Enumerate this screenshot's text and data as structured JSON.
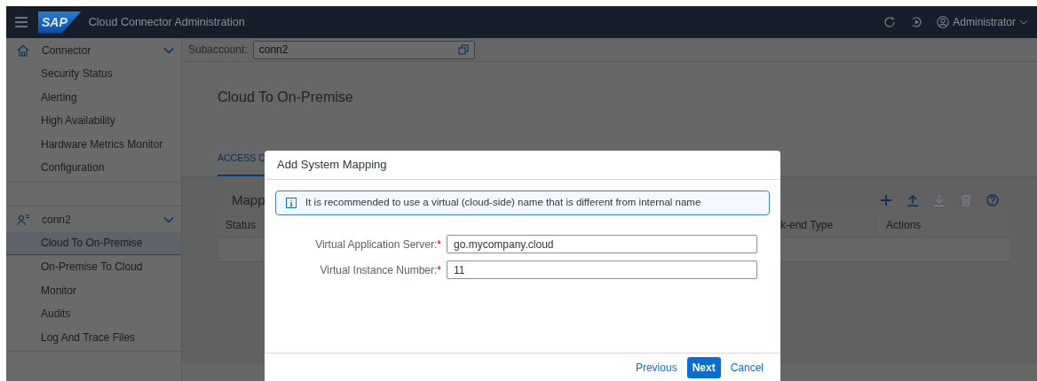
{
  "shellbar": {
    "logo": "SAP",
    "title": "Cloud Connector Administration",
    "user": "Administrator"
  },
  "sidebar": {
    "groups": [
      {
        "label": "Connector",
        "expanded": true,
        "items": [
          {
            "label": "Security Status",
            "selected": false
          },
          {
            "label": "Alerting",
            "selected": false
          },
          {
            "label": "High Availability",
            "selected": false
          },
          {
            "label": "Hardware Metrics Monitor",
            "selected": false
          },
          {
            "label": "Configuration",
            "selected": false
          }
        ]
      },
      {
        "label": "conn2",
        "expanded": true,
        "items": [
          {
            "label": "Cloud To On-Premise",
            "selected": true
          },
          {
            "label": "On-Premise To Cloud",
            "selected": false
          },
          {
            "label": "Monitor",
            "selected": false
          },
          {
            "label": "Audits",
            "selected": false
          },
          {
            "label": "Log And Trace Files",
            "selected": false
          }
        ]
      }
    ]
  },
  "subaccount": {
    "label": "Subaccount:",
    "value": "conn2"
  },
  "page_title": "Cloud To On-Premise",
  "tabs": [
    {
      "label": "ACCESS C",
      "selected": true
    }
  ],
  "mapping_panel": {
    "title": "Mapp",
    "toolbar": [
      {
        "disabled": false
      },
      {
        "disabled": false
      },
      {
        "disabled": true
      },
      {
        "disabled": true
      },
      {
        "disabled": false
      }
    ],
    "columns": [
      "Status",
      "k-end Type",
      "Actions"
    ]
  },
  "dialog": {
    "title": "Add System Mapping",
    "info": "It is recommended to use a virtual (cloud-side) name that is different from internal name",
    "fields": [
      {
        "label": "Virtual Application Server:",
        "required_mark": "*",
        "value": "go.mycompany.cloud"
      },
      {
        "label": "Virtual Instance Number:",
        "required_mark": "*",
        "value": "11"
      }
    ],
    "buttons": [
      {
        "label": "Previous",
        "kind": "link"
      },
      {
        "label": "Next",
        "kind": "primary"
      },
      {
        "label": "Cancel",
        "kind": "link"
      }
    ]
  }
}
